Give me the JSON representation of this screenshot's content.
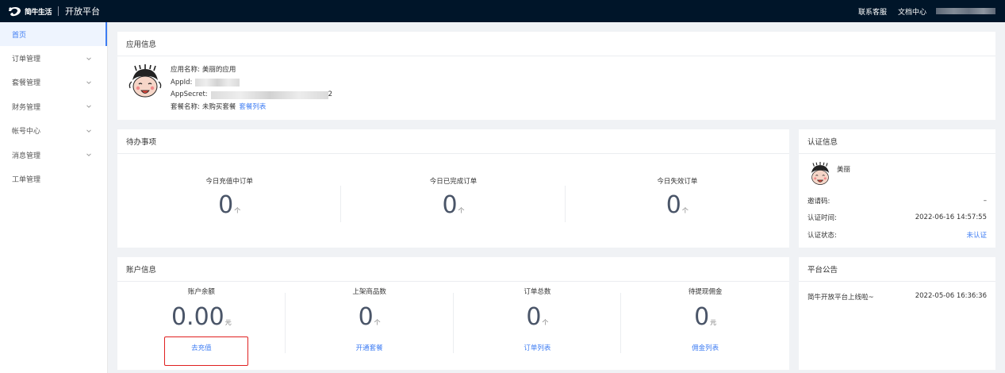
{
  "header": {
    "logo_text": "简牛生活",
    "platform": "开放平台",
    "links": [
      "联系客服",
      "文档中心"
    ]
  },
  "sidebar": {
    "items": [
      {
        "label": "首页",
        "active": true,
        "expandable": false
      },
      {
        "label": "订单管理",
        "active": false,
        "expandable": true
      },
      {
        "label": "套餐管理",
        "active": false,
        "expandable": true
      },
      {
        "label": "财务管理",
        "active": false,
        "expandable": true
      },
      {
        "label": "帐号中心",
        "active": false,
        "expandable": true
      },
      {
        "label": "消息管理",
        "active": false,
        "expandable": true
      },
      {
        "label": "工单管理",
        "active": false,
        "expandable": false
      }
    ]
  },
  "app_info": {
    "title": "应用信息",
    "name_label": "应用名称:",
    "name_value": "美丽的应用",
    "appid_label": "AppId:",
    "secret_label": "AppSecret:",
    "secret_suffix": "2",
    "package_label": "套餐名称:",
    "package_value": "未购买套餐",
    "package_link": "套餐列表"
  },
  "todo": {
    "title": "待办事项",
    "items": [
      {
        "label": "今日充值中订单",
        "value": "0",
        "unit": "个"
      },
      {
        "label": "今日已完成订单",
        "value": "0",
        "unit": "个"
      },
      {
        "label": "今日失效订单",
        "value": "0",
        "unit": "个"
      }
    ]
  },
  "cert": {
    "title": "认证信息",
    "name": "美丽",
    "rows": [
      {
        "label": "邀请码:",
        "value": "–"
      },
      {
        "label": "认证时间:",
        "value": "2022-06-16 14:57:55"
      },
      {
        "label": "认证状态:",
        "value": "未认证"
      }
    ]
  },
  "account": {
    "title": "账户信息",
    "items": [
      {
        "label": "账户余额",
        "value": "0.00",
        "unit": "元",
        "link": "去充值"
      },
      {
        "label": "上架商品数",
        "value": "0",
        "unit": "个",
        "link": "开通套餐"
      },
      {
        "label": "订单总数",
        "value": "0",
        "unit": "个",
        "link": "订单列表"
      },
      {
        "label": "待提现佣金",
        "value": "0",
        "unit": "元",
        "link": "佣金列表"
      }
    ]
  },
  "notice": {
    "title": "平台公告",
    "items": [
      {
        "text": "简牛开放平台上线啦~",
        "time": "2022-05-06 16:36:36"
      }
    ]
  },
  "colors": {
    "header_bg": "#001529",
    "accent": "#3d7cf3",
    "highlight_border": "#e02020",
    "page_bg": "#f0f2f5"
  }
}
